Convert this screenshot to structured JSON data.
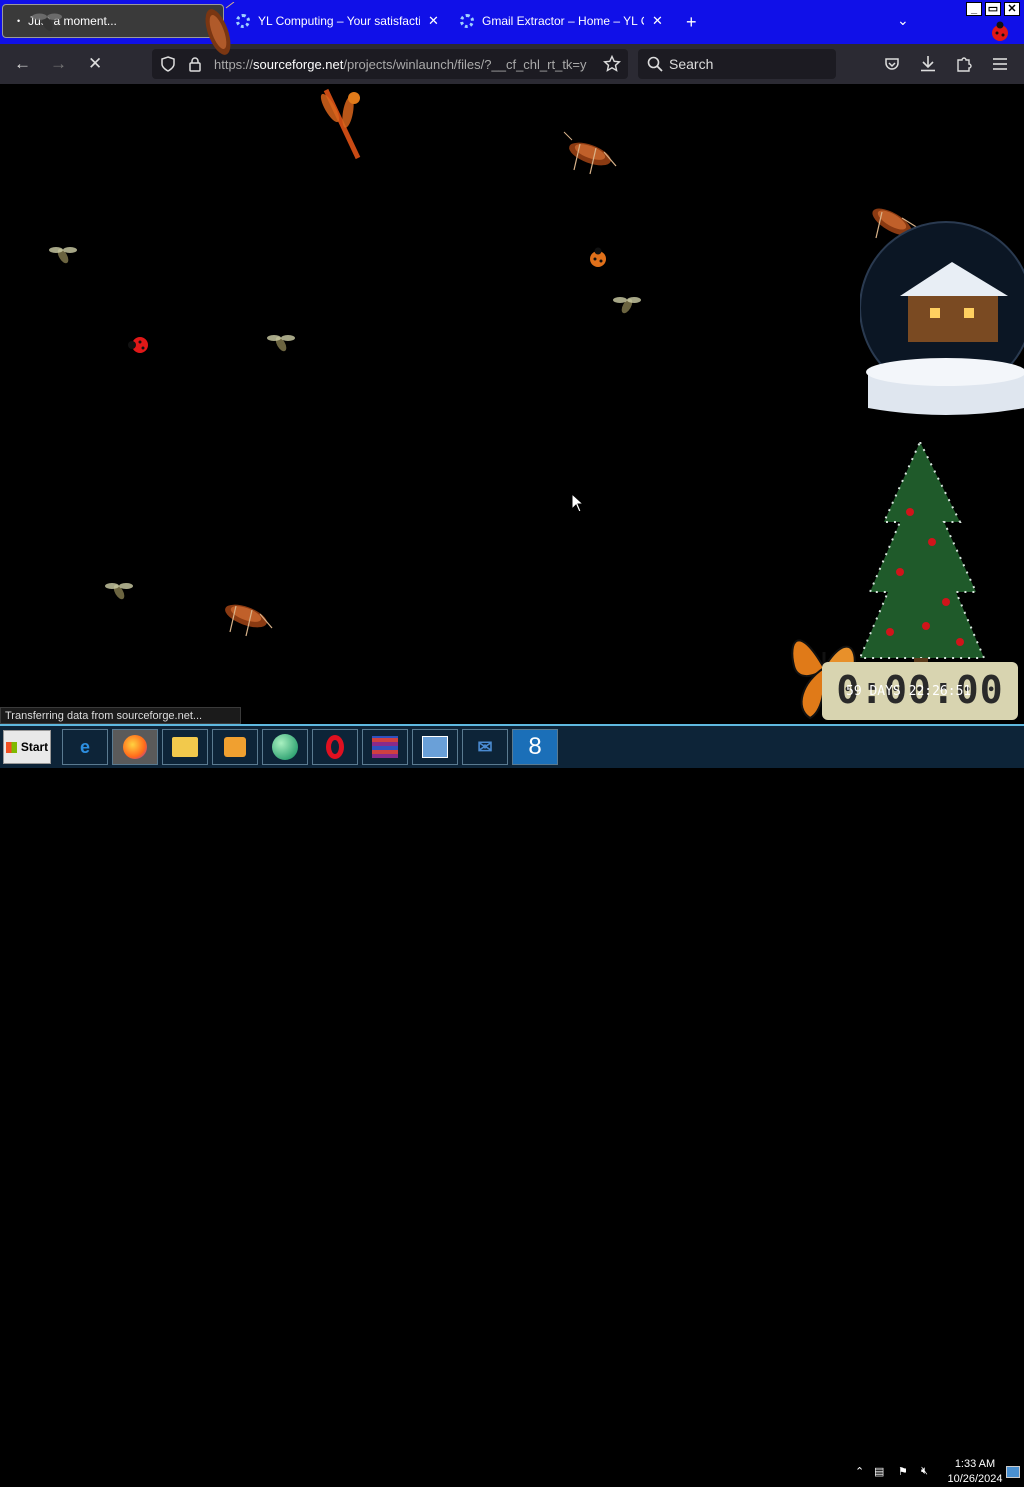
{
  "browser": {
    "tabs": [
      {
        "title": "Just a moment...",
        "active": true
      },
      {
        "title": "YL Computing – Your satisfaction i",
        "active": false
      },
      {
        "title": "Gmail Extractor – Home – YL Compu",
        "active": false
      }
    ],
    "new_tab_label": "+",
    "tab_list_label": "⌄",
    "window_controls": {
      "minimize": "_",
      "maximize": "▭",
      "close": "✕"
    },
    "nav": {
      "back": "←",
      "forward": "→",
      "stop": "✕",
      "url_prefix": "https://",
      "url_domain": "sourceforge.net",
      "url_rest": "/projects/winlaunch/files/?__cf_chl_rt_tk=y",
      "search_placeholder": "Search"
    },
    "status_text": "Transferring data from sourceforge.net..."
  },
  "desktop": {
    "timer_digits": "0:00:00",
    "timer_label": "59 DAYS 22:26:51"
  },
  "taskbar": {
    "start_label": "Start",
    "apps": [
      "internet-explorer",
      "firefox",
      "file-explorer",
      "media-player",
      "browser-globe",
      "opera",
      "winrar",
      "control-panel",
      "mail",
      "app-8"
    ],
    "app8_glyph": "8",
    "clock_time": "1:33 AM",
    "clock_date": "10/26/2024"
  },
  "colors": {
    "tabbar_bg": "#1010e8",
    "navbar_bg": "#2b2a33",
    "taskbar_bg": "#0d2438",
    "taskbar_accent": "#5fb9e0"
  }
}
